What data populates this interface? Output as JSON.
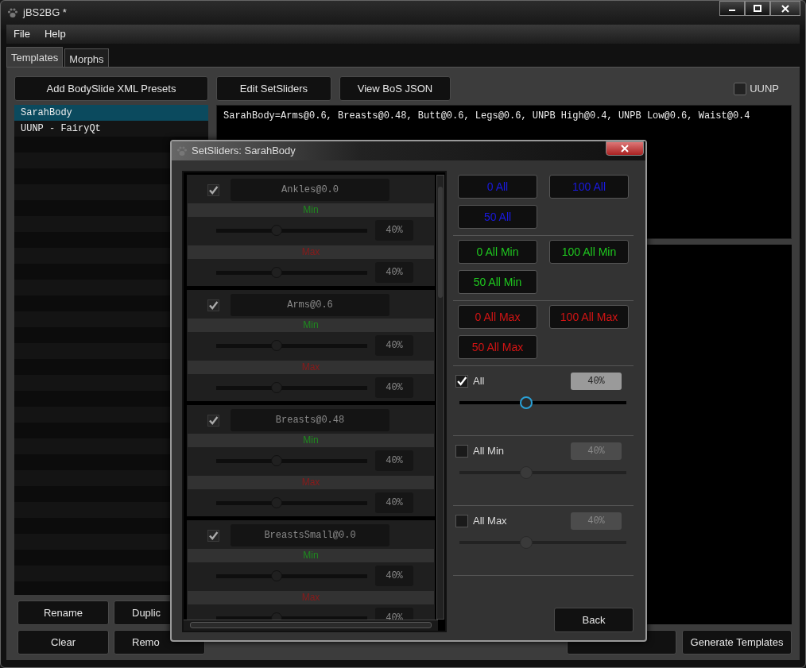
{
  "window": {
    "title": "jBS2BG *"
  },
  "menu": [
    "File",
    "Help"
  ],
  "tabs": [
    {
      "label": "Templates",
      "selected": true
    },
    {
      "label": "Morphs",
      "selected": false
    }
  ],
  "templates": {
    "add_button": "Add BodySlide XML Presets",
    "items": [
      {
        "label": "SarahBody",
        "selected": true
      },
      {
        "label": "UUNP - FairyQt",
        "selected": false
      }
    ],
    "buttons": [
      "Rename",
      "Duplic",
      "Clear",
      "Remo"
    ]
  },
  "toolbar": {
    "buttons": [
      "Edit SetSliders",
      "View BoS JSON"
    ],
    "uunp": {
      "label": "UUNP",
      "checked": false
    }
  },
  "output": {
    "text": "SarahBody=Arms@0.6, Breasts@0.48, Butt@0.6, Legs@0.6, UNPB High@0.4, UNPB Low@0.6, Waist@0.4"
  },
  "generate_button": "Generate Templates",
  "dialog": {
    "title": "SetSliders: SarahBody",
    "sliders": [
      {
        "name": "Ankles@0.0",
        "checked": true,
        "min_label": "Min",
        "min": {
          "level": 0.4,
          "reading": "40%"
        },
        "max_label": "Max",
        "max": {
          "level": 0.4,
          "reading": "40%"
        }
      },
      {
        "name": "Arms@0.6",
        "checked": true,
        "min_label": "Min",
        "min": {
          "level": 0.4,
          "reading": "40%"
        },
        "max_label": "Max",
        "max": {
          "level": 0.4,
          "reading": "40%"
        }
      },
      {
        "name": "Breasts@0.48",
        "checked": true,
        "min_label": "Min",
        "min": {
          "level": 0.4,
          "reading": "40%"
        },
        "max_label": "Max",
        "max": {
          "level": 0.4,
          "reading": "40%"
        }
      },
      {
        "name": "BreastsSmall@0.0",
        "checked": true,
        "min_label": "Min",
        "min": {
          "level": 0.4,
          "reading": "40%"
        },
        "max_label": "Max",
        "max": {
          "level": 0.4,
          "reading": "40%"
        }
      }
    ],
    "button_groups": [
      {
        "kind": "all",
        "buttons": [
          "0 All",
          "100 All",
          "50 All"
        ]
      },
      {
        "kind": "min",
        "buttons": [
          "0 All Min",
          "100 All Min",
          "50 All Min"
        ]
      },
      {
        "kind": "max",
        "buttons": [
          "0 All Max",
          "100 All Max",
          "50 All Max"
        ]
      }
    ],
    "controls": [
      {
        "label": "All",
        "checked": true,
        "reading": "40%",
        "level": 0.4
      },
      {
        "label": "All Min",
        "checked": false,
        "reading": "40%",
        "level": 0.4
      },
      {
        "label": "All Max",
        "checked": false,
        "reading": "40%",
        "level": 0.4
      }
    ],
    "back_button": "Back"
  }
}
